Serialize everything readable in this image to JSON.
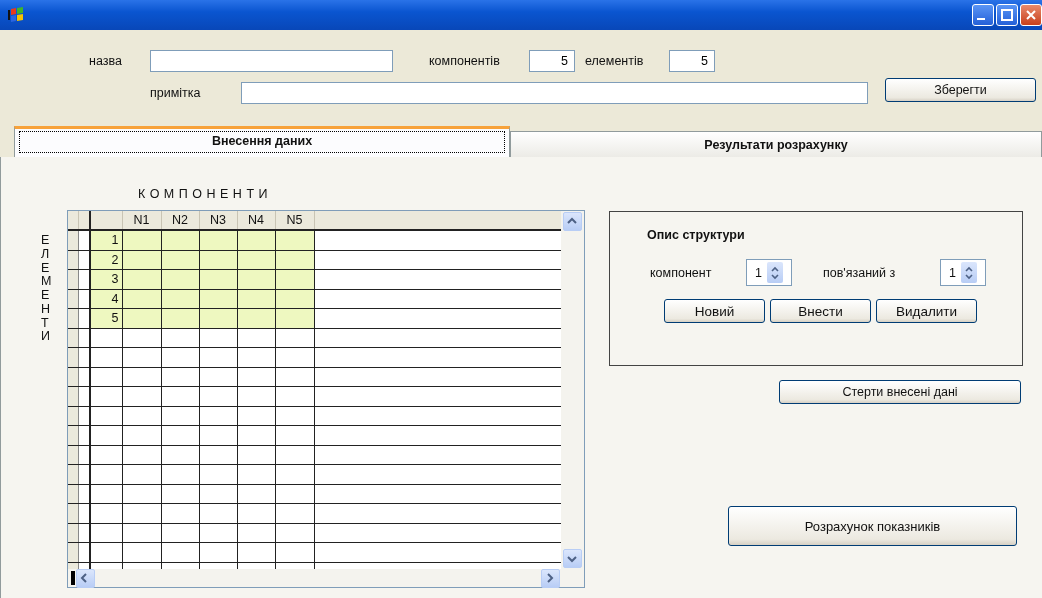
{
  "form": {
    "name_field": {
      "label": "назва"
    },
    "components_count": {
      "label": "компонентів",
      "value": "5"
    },
    "elements_count": {
      "label": "елементів",
      "value": "5"
    },
    "note_field": {
      "label": "примітка"
    },
    "save_button": "Зберегти"
  },
  "tabs": [
    {
      "label": "Внесення даних",
      "selected": true
    },
    {
      "label": "Результати розрахунку",
      "selected": false
    }
  ],
  "grid": {
    "column_title": "КОМПОНЕНТИ",
    "row_title": "ЕЛЕМЕНТИ",
    "columns": [
      "N1",
      "N2",
      "N3",
      "N4",
      "N5"
    ],
    "rows": [
      "1",
      "2",
      "3",
      "4",
      "5"
    ]
  },
  "structure": {
    "title": "Опис структури",
    "component": {
      "label": "компонент",
      "value": "1"
    },
    "linked_to": {
      "label": "пов'язаний з",
      "value": "1"
    },
    "buttons": [
      "Новий",
      "Внести",
      "Видалити"
    ]
  },
  "clear_button": "Стерти внесені дані",
  "calculate_button": "Розрахунок показників"
}
